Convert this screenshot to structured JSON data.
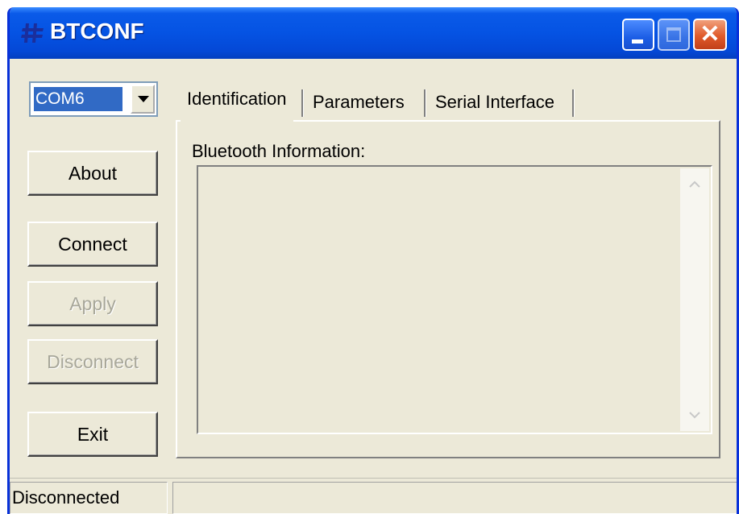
{
  "window": {
    "title": "BTCONF",
    "controls": {
      "minimize": "minimize-icon",
      "maximize": "maximize-icon",
      "close": "close-icon"
    }
  },
  "port_select": {
    "value": "COM6"
  },
  "buttons": {
    "about": "About",
    "connect": "Connect",
    "apply": "Apply",
    "disconnect": "Disconnect",
    "exit": "Exit"
  },
  "tabs": [
    {
      "label": "Identification",
      "active": true
    },
    {
      "label": "Parameters",
      "active": false
    },
    {
      "label": "Serial Interface",
      "active": false
    }
  ],
  "identification": {
    "bluetooth_info_label": "Bluetooth Information:",
    "bluetooth_info_value": ""
  },
  "status_bar": {
    "connection_status": "Disconnected",
    "message": ""
  },
  "colors": {
    "titlebar": "#0553e3",
    "window_bg": "#ece9d8",
    "selection": "#316ac5",
    "close_button": "#e05a2a"
  }
}
